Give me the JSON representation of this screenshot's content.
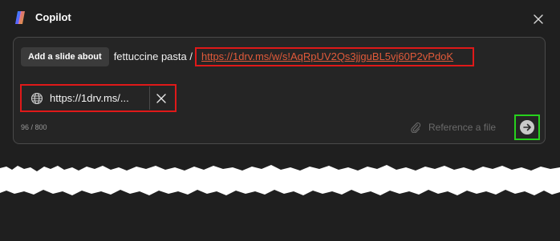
{
  "header": {
    "title": "Copilot",
    "logo_icon": "copilot-logo-icon",
    "close_icon": "close-icon"
  },
  "composer": {
    "prompt_chip": "Add a slide about",
    "prompt_text": "fettuccine pasta /",
    "url_text": "https://1drv.ms/w/s!AqRpUV2Qs3jjguBL5vj60P2vPdoK",
    "attachment": {
      "icon": "globe-icon",
      "label": "https://1drv.ms/...",
      "remove_icon": "close-icon"
    },
    "char_count": "96 / 800",
    "reference_label": "Reference a file",
    "reference_icon": "paperclip-icon",
    "send_icon": "arrow-right-icon"
  },
  "colors": {
    "background": "#1f1f1f",
    "card": "#252525",
    "highlight_red": "#e01919",
    "highlight_green": "#27d11d",
    "link": "#e05a3a"
  }
}
